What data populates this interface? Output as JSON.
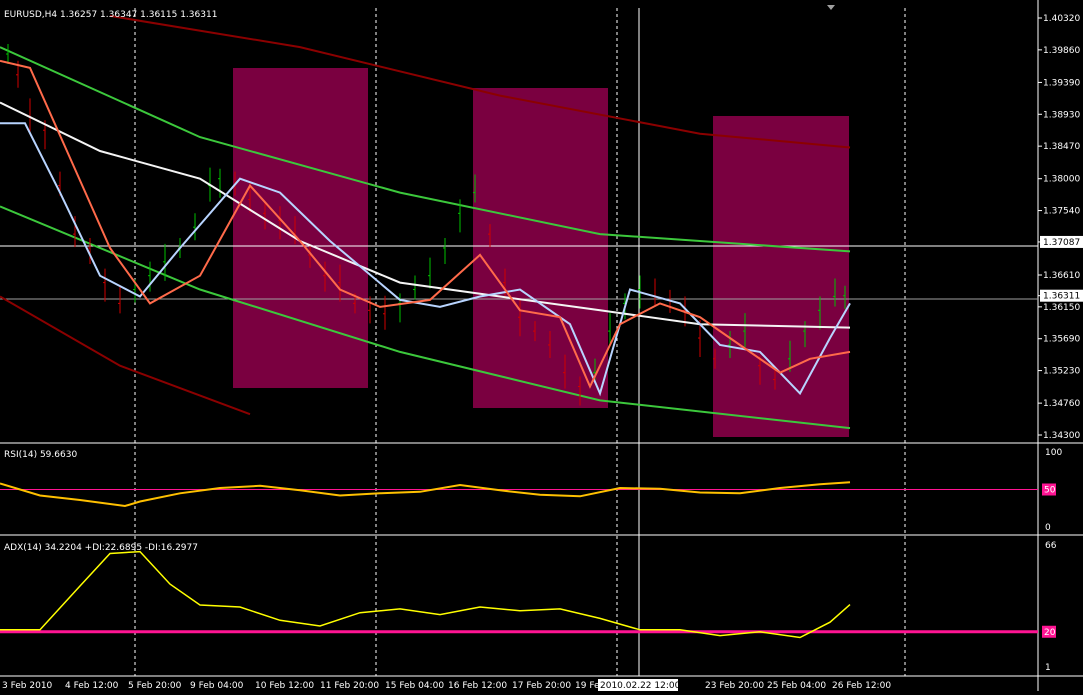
{
  "colors": {
    "background": "#000000",
    "grid": "#ffffff",
    "box": "#7a0040",
    "ma_white": "#f4f4f4",
    "ma_lightblue": "#b8d4ff",
    "ma_salmon": "#ff6a4a",
    "channel_green": "#3cc83c",
    "channel_darkred": "#8b0000",
    "bull": "#00c000",
    "bear": "#d00000",
    "rsi": "#ffc000",
    "adx": "#ffff00",
    "level": "#ff1493",
    "marker_bg": "#ff1493"
  },
  "main": {
    "label": "EURUSD,H4  1.36257 1.36347 1.36115 1.36311",
    "price_ticks": [
      "1.40320",
      "1.39860",
      "1.39390",
      "1.38930",
      "1.38470",
      "1.38000",
      "1.37540",
      "1.37087",
      "1.36610",
      "1.36311",
      "1.36150",
      "1.35690",
      "1.35230",
      "1.34760",
      "1.34300"
    ],
    "marker_top": "1.37087",
    "marker_current": "1.36311"
  },
  "rsi": {
    "label": "RSI(14) 59.6630",
    "ticks": [
      "100",
      "50",
      "0"
    ],
    "level_label": "50"
  },
  "adx": {
    "label": "ADX(14) 34.2204 +DI:22.6895 -DI:16.2977",
    "ticks": [
      "66",
      "20",
      "1"
    ],
    "level_label": "20"
  },
  "time_labels": [
    "3 Feb 2010",
    "4 Feb 12:00",
    "5 Feb 20:00",
    "9 Feb 04:00",
    "10 Feb 12:00",
    "11 Feb 20:00",
    "15 Feb 04:00",
    "16 Feb 12:00",
    "17 Feb 20:00",
    "19 Feb",
    "2010.02.22 12:00",
    "23 Feb 20:00",
    "25 Feb 04:00",
    "26 Feb 12:00"
  ],
  "chart_data": [
    {
      "type": "line",
      "title": "EURUSD,H4",
      "ylim": [
        1.343,
        1.4032
      ],
      "series": [
        {
          "x": [
            0,
            100,
            200,
            300,
            400,
            500,
            600,
            700,
            850
          ],
          "values": [
            1.391,
            1.384,
            1.38,
            1.371,
            1.365,
            1.363,
            1.361,
            1.359,
            1.3585
          ]
        },
        {
          "x": [
            0,
            25,
            60,
            100,
            140,
            180,
            240,
            280,
            330,
            400,
            440,
            480,
            520,
            570,
            600,
            630,
            680,
            720,
            760,
            800,
            830,
            850
          ],
          "values": [
            1.388,
            1.388,
            1.378,
            1.366,
            1.363,
            1.37,
            1.38,
            1.378,
            1.371,
            1.3625,
            1.3615,
            1.363,
            1.364,
            1.359,
            1.349,
            1.364,
            1.362,
            1.356,
            1.355,
            1.349,
            1.357,
            1.362
          ]
        },
        {
          "x": [
            0,
            30,
            70,
            110,
            150,
            200,
            250,
            300,
            340,
            380,
            430,
            480,
            520,
            560,
            590,
            620,
            660,
            700,
            740,
            780,
            810,
            850
          ],
          "values": [
            1.397,
            1.396,
            1.383,
            1.37,
            1.362,
            1.366,
            1.379,
            1.371,
            1.364,
            1.3615,
            1.3625,
            1.369,
            1.361,
            1.36,
            1.35,
            1.359,
            1.362,
            1.36,
            1.356,
            1.352,
            1.354,
            1.355
          ]
        },
        {
          "x": [
            0,
            200,
            400,
            600,
            850
          ],
          "values": [
            1.399,
            1.386,
            1.378,
            1.372,
            1.3695
          ]
        },
        {
          "x": [
            0,
            200,
            400,
            600,
            850
          ],
          "values": [
            1.376,
            1.364,
            1.355,
            1.348,
            1.344
          ]
        },
        {
          "x": [
            110,
            300,
            500,
            700,
            850
          ],
          "values": [
            1.4035,
            1.399,
            1.392,
            1.3865,
            1.3845
          ]
        },
        {
          "x": [
            0,
            120,
            250
          ],
          "values": [
            1.363,
            1.353,
            1.346
          ]
        }
      ],
      "candles": {
        "x": [
          8,
          18,
          30,
          45,
          60,
          75,
          90,
          105,
          120,
          135,
          150,
          165,
          180,
          195,
          210,
          220,
          235,
          250,
          265,
          280,
          295,
          310,
          325,
          340,
          355,
          370,
          385,
          400,
          415,
          430,
          445,
          460,
          475,
          490,
          505,
          520,
          535,
          550,
          565,
          580,
          595,
          610,
          625,
          640,
          655,
          670,
          685,
          700,
          715,
          730,
          745,
          760,
          775,
          790,
          805,
          820,
          835,
          845
        ],
        "values": [
          1.398,
          1.395,
          1.389,
          1.387,
          1.379,
          1.372,
          1.37,
          1.365,
          1.362,
          1.364,
          1.366,
          1.368,
          1.37,
          1.373,
          1.379,
          1.38,
          1.379,
          1.377,
          1.375,
          1.374,
          1.372,
          1.369,
          1.366,
          1.365,
          1.362,
          1.361,
          1.3605,
          1.362,
          1.364,
          1.366,
          1.37,
          1.375,
          1.378,
          1.372,
          1.365,
          1.36,
          1.358,
          1.356,
          1.352,
          1.35,
          1.352,
          1.358,
          1.362,
          1.364,
          1.363,
          1.3625,
          1.361,
          1.357,
          1.354,
          1.356,
          1.358,
          1.353,
          1.351,
          1.354,
          1.358,
          1.361,
          1.363,
          1.3631
        ]
      }
    },
    {
      "type": "line",
      "title": "RSI(14) 59.6630",
      "ylim": [
        0,
        100
      ],
      "series": [
        {
          "name": "RSI(14)",
          "x": [
            0,
            40,
            80,
            125,
            140,
            180,
            220,
            260,
            300,
            340,
            380,
            420,
            460,
            500,
            540,
            580,
            620,
            660,
            700,
            740,
            780,
            820,
            850
          ],
          "values": [
            58,
            42,
            36,
            28,
            34,
            45,
            52,
            55,
            49,
            42,
            45,
            47,
            56,
            49,
            43,
            41,
            52,
            51,
            46,
            45,
            52,
            57,
            59.66
          ]
        }
      ]
    },
    {
      "type": "line",
      "title": "ADX(14) 34.2204 +DI:22.6895 -DI:16.2977",
      "ylim": [
        1,
        66
      ],
      "series": [
        {
          "name": "ADX(14)",
          "x": [
            0,
            40,
            80,
            110,
            140,
            170,
            200,
            240,
            280,
            320,
            360,
            400,
            440,
            480,
            520,
            560,
            600,
            640,
            680,
            720,
            760,
            800,
            830,
            850
          ],
          "values": [
            21,
            21,
            44,
            61,
            62,
            45,
            34,
            33,
            26,
            23,
            30,
            32,
            29,
            33,
            31,
            32,
            27,
            21,
            21,
            18,
            20,
            17,
            25,
            34.22
          ]
        }
      ]
    }
  ]
}
